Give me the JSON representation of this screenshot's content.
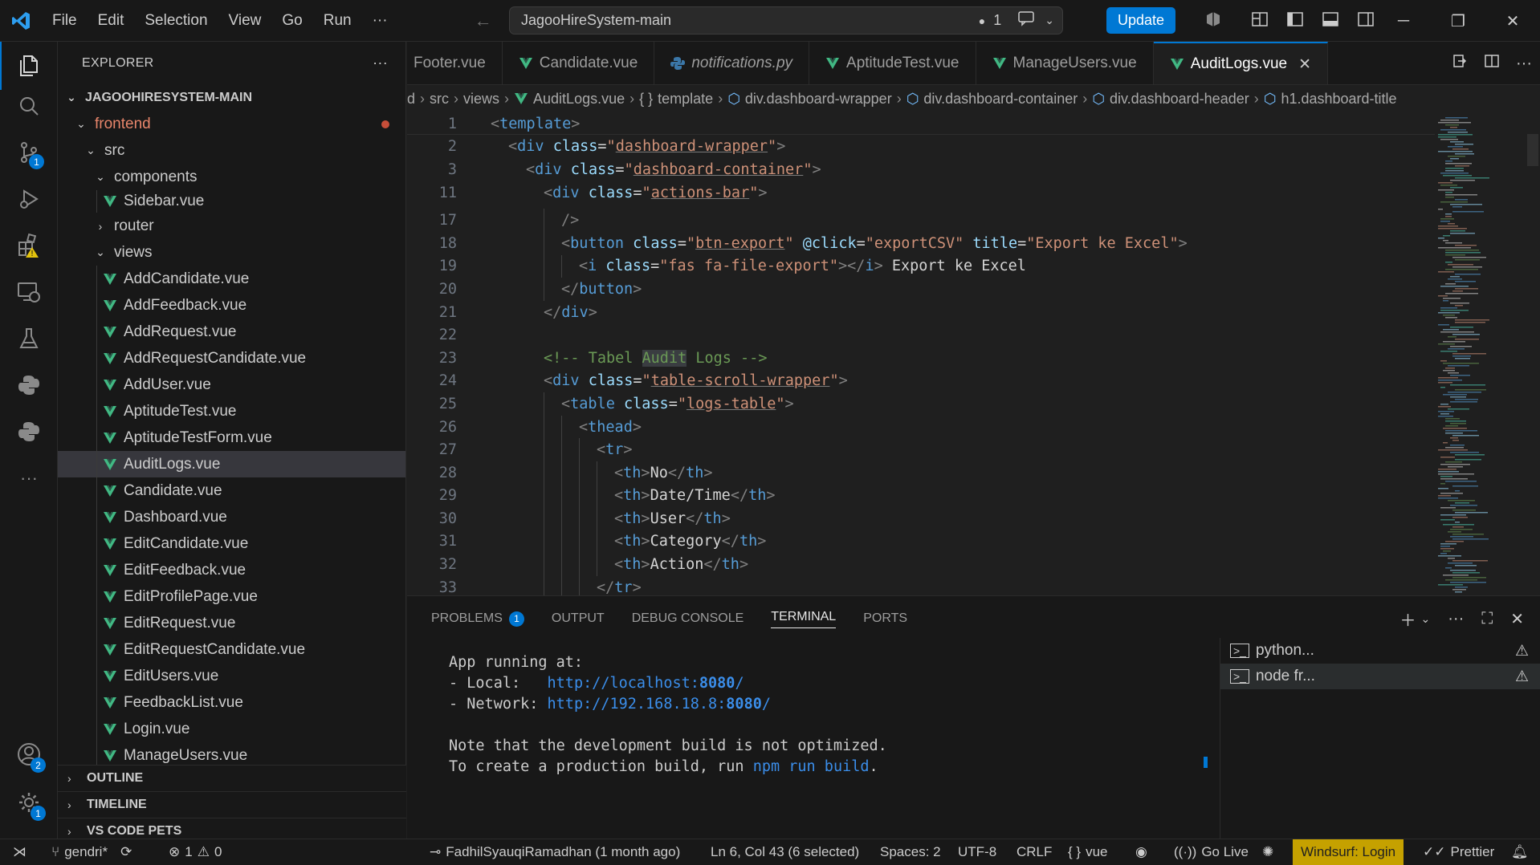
{
  "titlebar": {
    "menu": [
      "File",
      "Edit",
      "Selection",
      "View",
      "Go",
      "Run"
    ],
    "more": "···",
    "search_text": "JagooHireSystem-main",
    "dirty_count": "1",
    "update_label": "Update"
  },
  "activity": {
    "source_control_badge": "1",
    "accounts_badge": "2",
    "settings_badge": "1"
  },
  "sidebar": {
    "title": "EXPLORER",
    "more": "···",
    "root": "JAGOOHIRESYSTEM-MAIN",
    "frontend": "frontend",
    "src": "src",
    "components": "components",
    "sidebar_file": "Sidebar.vue",
    "router": "router",
    "views": "views",
    "files": [
      "AddCandidate.vue",
      "AddFeedback.vue",
      "AddRequest.vue",
      "AddRequestCandidate.vue",
      "AddUser.vue",
      "AptitudeTest.vue",
      "AptitudeTestForm.vue",
      "AuditLogs.vue",
      "Candidate.vue",
      "Dashboard.vue",
      "EditCandidate.vue",
      "EditFeedback.vue",
      "EditProfilePage.vue",
      "EditRequest.vue",
      "EditRequestCandidate.vue",
      "EditUsers.vue",
      "FeedbackList.vue",
      "Login.vue",
      "ManageUsers.vue"
    ],
    "sections": [
      "OUTLINE",
      "TIMELINE",
      "VS CODE PETS"
    ]
  },
  "tabs": [
    {
      "label": "Footer.vue",
      "kind": "vue"
    },
    {
      "label": "Candidate.vue",
      "kind": "vue"
    },
    {
      "label": "notifications.py",
      "kind": "python"
    },
    {
      "label": "AptitudeTest.vue",
      "kind": "vue"
    },
    {
      "label": "ManageUsers.vue",
      "kind": "vue"
    },
    {
      "label": "AuditLogs.vue",
      "kind": "vue"
    }
  ],
  "breadcrumb": [
    "d",
    "src",
    "views",
    "AuditLogs.vue",
    "template",
    "div.dashboard-wrapper",
    "div.dashboard-container",
    "div.dashboard-header",
    "h1.dashboard-title"
  ],
  "code": {
    "line_numbers": [
      "1",
      "2",
      "3",
      "11",
      "17",
      "18",
      "19",
      "20",
      "21",
      "22",
      "23",
      "24",
      "25",
      "26",
      "27",
      "28",
      "29",
      "30",
      "31",
      "32",
      "33"
    ],
    "l1_tag": "template",
    "l2_attr": "class",
    "l2_val": "dashboard-wrapper",
    "l3_val": "dashboard-container",
    "l11_val": "actions-bar",
    "l17": "/>",
    "l18_tag": "button",
    "l18_val": "btn-export",
    "l18_event": "@click",
    "l18_handler": "exportCSV",
    "l18_title_attr": "title",
    "l18_title": "Export ke Excel",
    "l19_tag": "i",
    "l19_val": "fas fa-file-export",
    "l19_text": " Export ke Excel",
    "l20_tag": "button",
    "l21_tag": "div",
    "l23_comment_a": "<!-- Tabel ",
    "l23_comment_b": "Audit",
    "l23_comment_c": " Logs -->",
    "l24_val": "table-scroll-wrapper",
    "l25_tag": "table",
    "l25_val": "logs-table",
    "l26_tag": "thead",
    "l27_tag": "tr",
    "headers": [
      "No",
      "Date/Time",
      "User",
      "Category",
      "Action"
    ],
    "th": "th",
    "div": "div"
  },
  "panel": {
    "tabs": [
      "PROBLEMS",
      "OUTPUT",
      "DEBUG CONSOLE",
      "TERMINAL",
      "PORTS"
    ],
    "problems_badge": "1",
    "terminal": {
      "line1": "App running at:",
      "local_label": "- Local:   ",
      "local_url_a": "http://localhost:",
      "local_url_b": "8080",
      "local_url_c": "/",
      "network_label": "- Network: ",
      "network_url_a": "http://192.168.18.8:",
      "network_url_b": "8080",
      "network_url_c": "/",
      "note1": "Note that the development build is not optimized.",
      "note2_a": "To create a production build, run ",
      "note2_cmd": "npm run build",
      "note2_c": "."
    },
    "terminals": [
      "python...",
      "node fr..."
    ]
  },
  "statusbar": {
    "branch": "gendri*",
    "errors": "1",
    "warnings": "0",
    "blame": "FadhilSyauqiRamadhan (1 month ago)",
    "position": "Ln 6, Col 43 (6 selected)",
    "spaces": "Spaces: 2",
    "encoding": "UTF-8",
    "eol": "CRLF",
    "language": "vue",
    "golive": "Go Live",
    "windsurf": "Windsurf: Login",
    "prettier": "Prettier"
  },
  "colors": {
    "accent": "#0078d4",
    "vue_green": "#41b883",
    "modified_dot": "#c74e39",
    "windsurf_bg": "#c5a100"
  }
}
